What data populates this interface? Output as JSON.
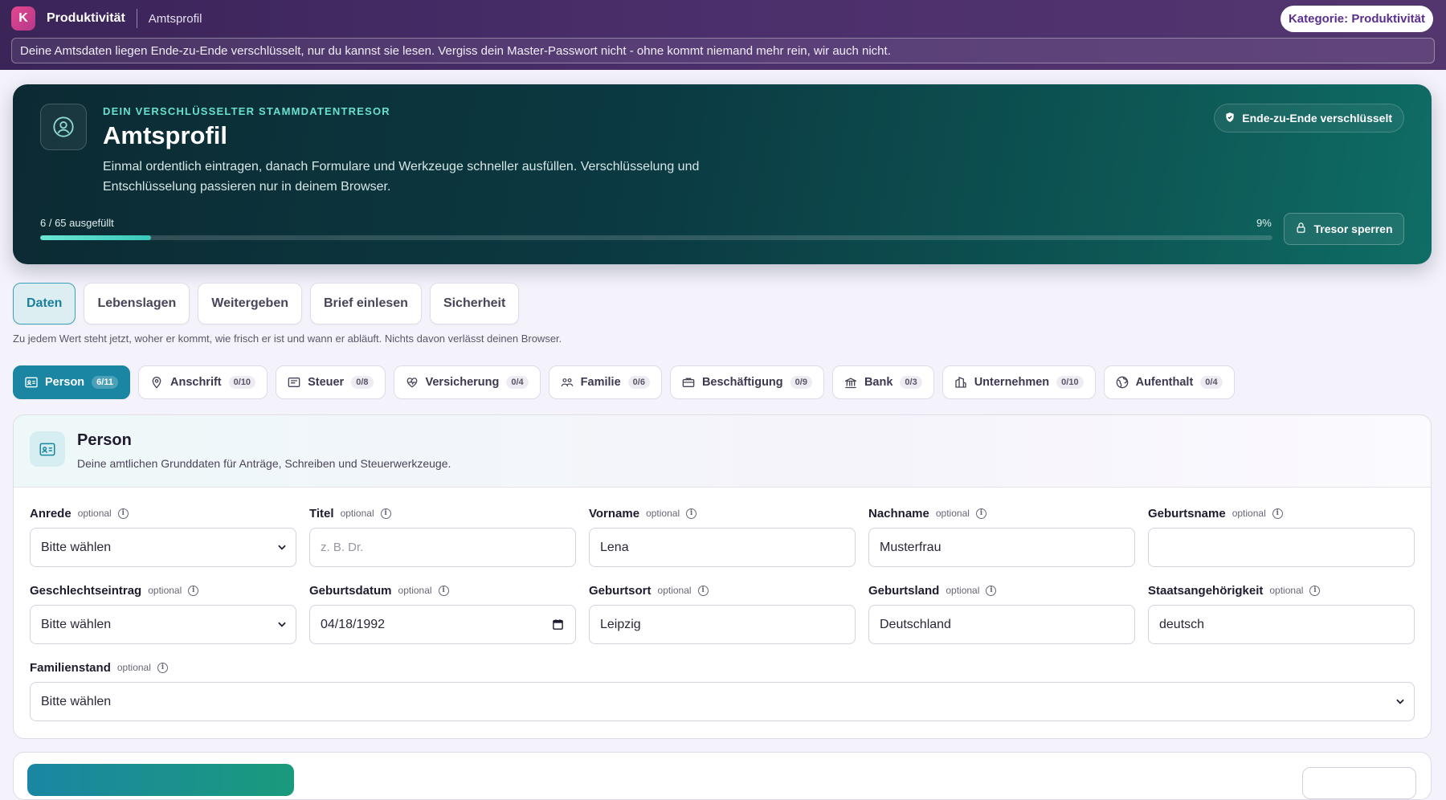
{
  "app": {
    "logo_letter": "K",
    "name": "Produktivität",
    "page": "Amtsprofil",
    "category_badge": "Kategorie: Produktivität"
  },
  "notice": "Deine Amtsdaten liegen Ende-zu-Ende verschlüsselt, nur du kannst sie lesen. Vergiss dein Master-Passwort nicht - ohne kommt niemand mehr rein, wir auch nicht.",
  "hero": {
    "eyebrow": "DEIN VERSCHLÜSSELTER STAMMDATENTRESOR",
    "title": "Amtsprofil",
    "description": "Einmal ordentlich eintragen, danach Formulare und Werkzeuge schneller ausfüllen. Verschlüsselung und Entschlüsselung passieren nur in deinem Browser.",
    "badge": "Ende-zu-Ende verschlüsselt",
    "progress_label": "6 / 65 ausgefüllt",
    "progress_percent_label": "9%",
    "progress_fraction": 0.09,
    "lock_button": "Tresor sperren"
  },
  "tabs": [
    {
      "label": "Daten",
      "active": true
    },
    {
      "label": "Lebenslagen",
      "active": false
    },
    {
      "label": "Weitergeben",
      "active": false
    },
    {
      "label": "Brief einlesen",
      "active": false
    },
    {
      "label": "Sicherheit",
      "active": false
    }
  ],
  "hint": "Zu jedem Wert steht jetzt, woher er kommt, wie frisch er ist und wann er abläuft. Nichts davon verlässt deinen Browser.",
  "categories": [
    {
      "label": "Person",
      "count": "6/11",
      "icon": "id-card-icon",
      "active": true
    },
    {
      "label": "Anschrift",
      "count": "0/10",
      "icon": "map-pin-icon",
      "active": false
    },
    {
      "label": "Steuer",
      "count": "0/8",
      "icon": "receipt-icon",
      "active": false
    },
    {
      "label": "Versicherung",
      "count": "0/4",
      "icon": "heart-pulse-icon",
      "active": false
    },
    {
      "label": "Familie",
      "count": "0/6",
      "icon": "users-icon",
      "active": false
    },
    {
      "label": "Beschäftigung",
      "count": "0/9",
      "icon": "briefcase-icon",
      "active": false
    },
    {
      "label": "Bank",
      "count": "0/3",
      "icon": "bank-icon",
      "active": false
    },
    {
      "label": "Unternehmen",
      "count": "0/10",
      "icon": "building-icon",
      "active": false
    },
    {
      "label": "Aufenthalt",
      "count": "0/4",
      "icon": "globe-icon",
      "active": false
    }
  ],
  "panel": {
    "title": "Person",
    "subtitle": "Deine amtlichen Grunddaten für Anträge, Schreiben und Steuerwerkzeuge.",
    "optional_label": "optional",
    "fields": [
      {
        "label": "Anrede",
        "type": "select",
        "value": "Bitte wählen"
      },
      {
        "label": "Titel",
        "type": "text",
        "value": "",
        "placeholder": "z. B. Dr."
      },
      {
        "label": "Vorname",
        "type": "text",
        "value": "Lena"
      },
      {
        "label": "Nachname",
        "type": "text",
        "value": "Musterfrau"
      },
      {
        "label": "Geburtsname",
        "type": "text",
        "value": ""
      },
      {
        "label": "Geschlechtseintrag",
        "type": "select",
        "value": "Bitte wählen"
      },
      {
        "label": "Geburtsdatum",
        "type": "date",
        "value": "04/18/1992"
      },
      {
        "label": "Geburtsort",
        "type": "text",
        "value": "Leipzig"
      },
      {
        "label": "Geburtsland",
        "type": "text",
        "value": "Deutschland"
      },
      {
        "label": "Staatsangehörigkeit",
        "type": "text",
        "value": "deutsch"
      },
      {
        "label": "Familienstand",
        "type": "select",
        "value": "Bitte wählen"
      }
    ]
  },
  "colors": {
    "accent": "#1a86a3",
    "topbar": "#3a2458",
    "hero_teal": "#68e0cf"
  }
}
